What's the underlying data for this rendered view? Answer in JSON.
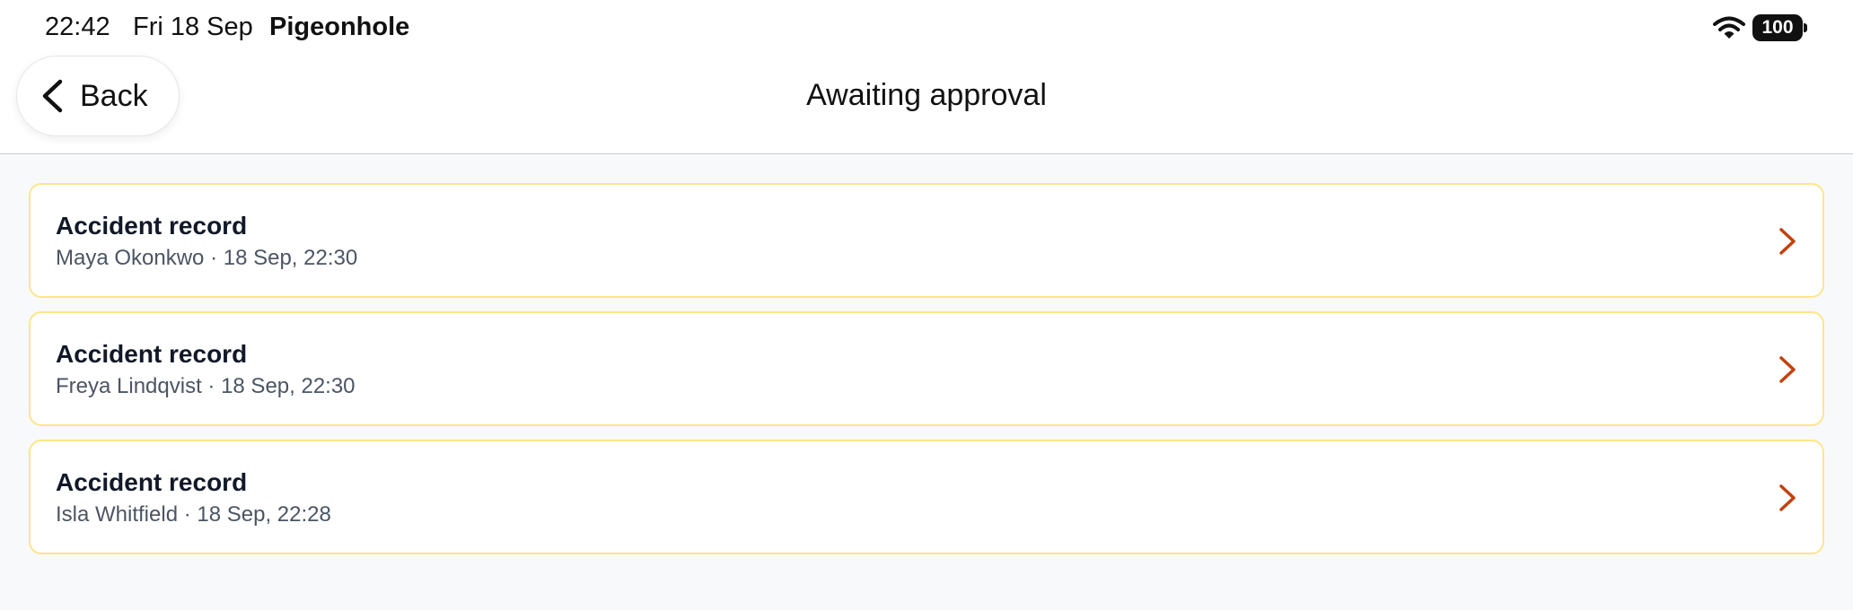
{
  "status_bar": {
    "time": "22:42",
    "date": "Fri 18 Sep",
    "app_name": "Pigeonhole",
    "battery": "100",
    "icons": [
      "wifi-icon",
      "battery-icon"
    ]
  },
  "nav": {
    "back_label": "Back",
    "title": "Awaiting approval",
    "icon": "chevron-left-icon"
  },
  "items": [
    {
      "title": "Accident record",
      "subtitle": "Maya Okonkwo · 18 Sep, 22:30"
    },
    {
      "title": "Accident record",
      "subtitle": "Freya Lindqvist · 18 Sep, 22:30"
    },
    {
      "title": "Accident record",
      "subtitle": "Isla Whitfield · 18 Sep, 22:28"
    }
  ],
  "colors": {
    "card_border": "#fde68a",
    "chevron_accent": "#c2410c",
    "background": "#f8f9fb"
  }
}
